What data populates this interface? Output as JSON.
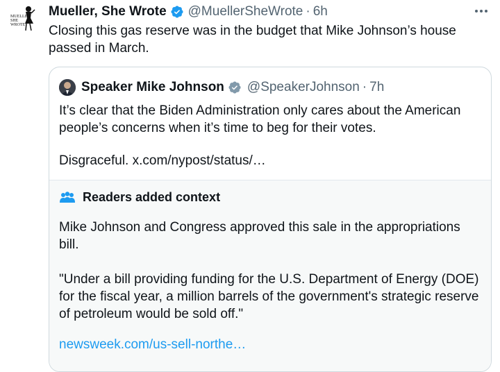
{
  "tweet": {
    "author_name": "Mueller, She Wrote",
    "handle": "@MuellerSheWrote",
    "separator": "·",
    "time": "6h",
    "text": "Closing this gas reserve was in the budget that Mike Johnson’s house passed in March.",
    "avatar_words": [
      "MUELLER",
      "SHE WROTE"
    ],
    "verified": true
  },
  "quote": {
    "author_name": "Speaker Mike Johnson",
    "handle": "@SpeakerJohnson",
    "separator": "·",
    "time": "7h",
    "text": "It’s clear that the Biden Administration only cares about the American people’s concerns when it’s time to beg for their votes.",
    "link_line": "Disgraceful. x.com/nypost/status/…",
    "verified_color": "#829aab"
  },
  "context": {
    "title": "Readers added context",
    "paragraph1": "Mike Johnson and Congress approved this sale in the appropriations bill.",
    "paragraph2": "\"Under a bill providing funding for the U.S. Department of Energy (DOE) for the fiscal year, a million barrels of the government's strategic reserve of petroleum would be sold off.\"",
    "link": "newsweek.com/us-sell-northe…"
  },
  "colors": {
    "text": "#0f1419",
    "secondary": "#536471",
    "accent": "#1d9bf0",
    "verified_blue": "#1d9bf0",
    "context_bg": "#f7f9f9",
    "border": "#cfd9de"
  },
  "icons": {
    "verified": "verified-badge-icon",
    "more": "more-options-icon",
    "context": "people-icon"
  }
}
